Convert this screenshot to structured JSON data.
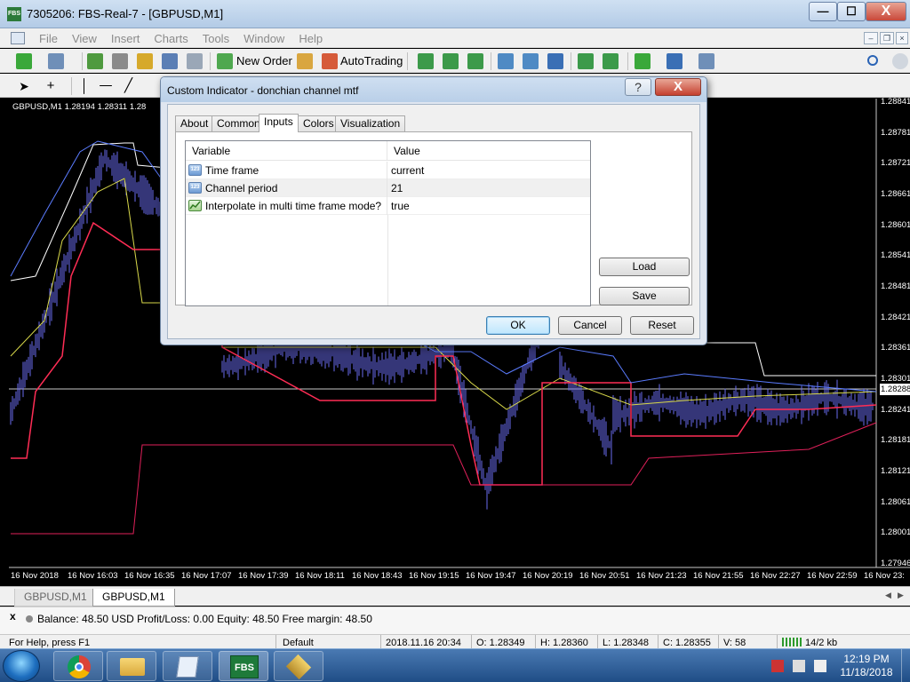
{
  "window": {
    "title": "7305206: FBS-Real-7 - [GBPUSD,M1]",
    "icon_text": "FBS",
    "minimize": "—",
    "maximize": "☐",
    "close": "X"
  },
  "menu": {
    "items": [
      "File",
      "View",
      "Insert",
      "Charts",
      "Tools",
      "Window",
      "Help"
    ],
    "mdi_minimize": "–",
    "mdi_restore": "❐",
    "mdi_close": "×"
  },
  "toolbar": {
    "new_order_label": "New Order",
    "autotrading_label": "AutoTrading"
  },
  "chart": {
    "header": "GBPUSD,M1  1.28194 1.28311 1.28",
    "current_price": "1.28288",
    "price_ticks": [
      "1.28841",
      "1.28781",
      "1.28721",
      "1.28661",
      "1.28601",
      "1.28541",
      "1.28481",
      "1.28421",
      "1.28361",
      "1.28301",
      "1.28241",
      "1.28181",
      "1.28121",
      "1.28061",
      "1.28001",
      "1.27946"
    ],
    "time_ticks": [
      "16 Nov 2018",
      "16 Nov 16:03",
      "16 Nov 16:35",
      "16 Nov 17:07",
      "16 Nov 17:39",
      "16 Nov 18:11",
      "16 Nov 18:43",
      "16 Nov 19:15",
      "16 Nov 19:47",
      "16 Nov 20:19",
      "16 Nov 20:51",
      "16 Nov 21:23",
      "16 Nov 21:55",
      "16 Nov 22:27",
      "16 Nov 22:59",
      "16 Nov 23:"
    ]
  },
  "chart_tabs": [
    "GBPUSD,M1",
    "GBPUSD,M1"
  ],
  "terminal": {
    "close": "x",
    "balance_line": "Balance: 48.50 USD  Profit/Loss: 0.00  Equity: 48.50  Free margin: 48.50"
  },
  "status": {
    "help": "For Help, press F1",
    "profile": "Default",
    "datetime": "2018.11.16 20:34",
    "open": "O: 1.28349",
    "high": "H: 1.28360",
    "low": "L: 1.28348",
    "close": "C: 1.28355",
    "volume": "V: 58",
    "traffic": "14/2 kb"
  },
  "taskbar": {
    "time": "12:19 PM",
    "date": "11/18/2018",
    "fbs_label": "FBS"
  },
  "dialog": {
    "title": "Custom Indicator - donchian channel mtf",
    "help": "?",
    "close": "X",
    "tabs": [
      "About",
      "Common",
      "Inputs",
      "Colors",
      "Visualization"
    ],
    "active_tab": "Inputs",
    "columns": [
      "Variable",
      "Value"
    ],
    "rows": [
      {
        "variable": "Time frame",
        "value": "current",
        "icon": "123"
      },
      {
        "variable": "Channel period",
        "value": "21",
        "icon": "123"
      },
      {
        "variable": "Interpolate in multi time frame mode?",
        "value": "true",
        "icon": "bool-icon"
      }
    ],
    "load": "Load",
    "save": "Save",
    "ok": "OK",
    "cancel": "Cancel",
    "reset": "Reset"
  },
  "colors": {
    "chart_bg": "#000000",
    "candles": "#6a6cf0",
    "upper_band": "#ffffff",
    "lower_band": "#ff2d55",
    "middle_band": "#d9d94a",
    "mtf_upper": "#5b7cff",
    "mtf_lower": "#e0205a"
  }
}
